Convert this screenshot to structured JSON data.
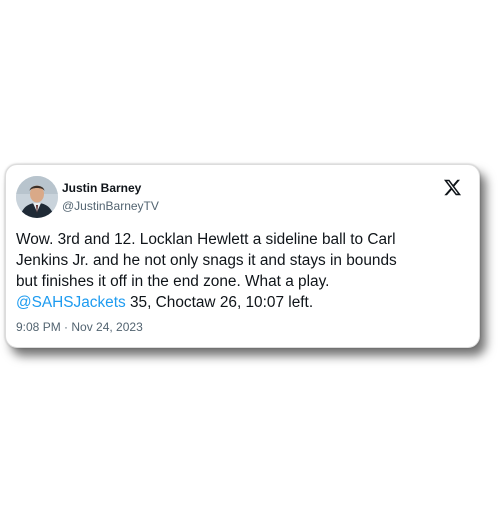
{
  "tweet": {
    "author": {
      "name": "Justin Barney",
      "handle": "@JustinBarneyTV"
    },
    "platform_icon": "x-logo-icon",
    "avatar_icon": "avatar-photo",
    "text": {
      "line1": "Wow. 3rd and 12. Locklan Hewlett a sideline ball to Carl",
      "line2": "Jenkins Jr. and he not only snags it and stays in bounds",
      "line3": "but finishes it off in the end zone. What a play.",
      "mention": "@SAHSJackets",
      "line4_rest": " 35, Choctaw 26, 10:07 left."
    },
    "timestamp": "9:08 PM · Nov 24, 2023"
  },
  "colors": {
    "text": "#0f1419",
    "secondary": "#536471",
    "link": "#1d9bf0",
    "background": "#ffffff"
  }
}
